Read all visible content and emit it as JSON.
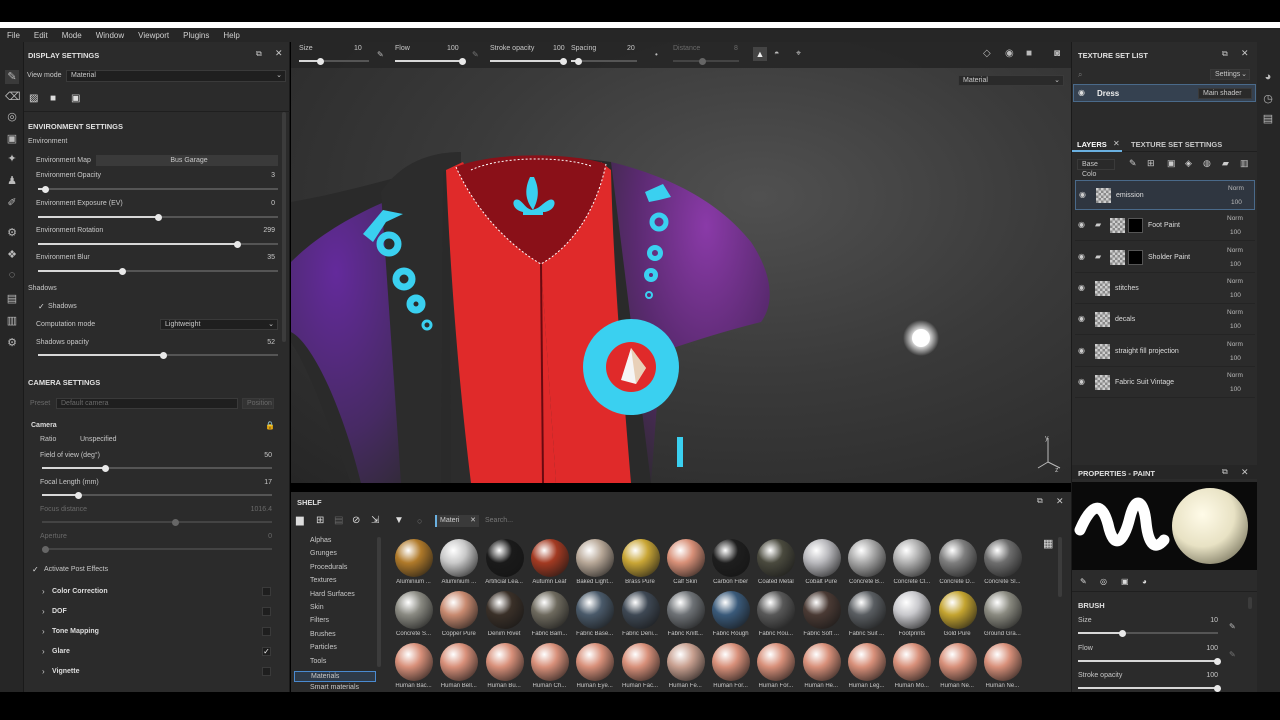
{
  "menu": [
    "File",
    "Edit",
    "Mode",
    "Window",
    "Viewport",
    "Plugins",
    "Help"
  ],
  "display_settings": {
    "title": "DISPLAY SETTINGS",
    "view_mode_label": "View mode",
    "view_mode_value": "Material",
    "environment_settings_title": "ENVIRONMENT SETTINGS",
    "environment_label": "Environment",
    "env_map_label": "Environment Map",
    "env_map_value": "Bus Garage",
    "sliders": [
      {
        "label": "Environment Opacity",
        "value": "3",
        "fraction": 0.03
      },
      {
        "label": "Environment Exposure (EV)",
        "value": "0",
        "fraction": 0.5
      },
      {
        "label": "Environment Rotation",
        "value": "299",
        "fraction": 0.83
      },
      {
        "label": "Environment Blur",
        "value": "35",
        "fraction": 0.35
      }
    ],
    "shadows_label": "Shadows",
    "shadows_check_label": "Shadows",
    "computation_label": "Computation mode",
    "computation_value": "Lightweight",
    "shadows_opacity_label": "Shadows opacity",
    "shadows_opacity_value": "52",
    "camera_settings_title": "CAMERA SETTINGS",
    "preset_label": "Preset",
    "preset_placeholder": "Default camera",
    "preset_btn": "Position",
    "camera_label": "Camera",
    "ratio_label": "Ratio",
    "ratio_value": "Unspecified",
    "fov_label": "Field of view (deg°)",
    "fov_value": "50",
    "focal_label": "Focal Length (mm)",
    "focal_value": "17",
    "focus_label": "Focus distance",
    "focus_value": "1016.4",
    "aperture_label": "Aperture",
    "aperture_value": "0",
    "post_effects_label": "Activate Post Effects",
    "post_effects": [
      "Color Correction",
      "DOF",
      "Tone Mapping",
      "Glare",
      "Vignette"
    ]
  },
  "brush_bar": {
    "size_label": "Size",
    "size_value": "10",
    "flow_label": "Flow",
    "flow_value": "100",
    "stroke_label": "Stroke opacity",
    "stroke_value": "100",
    "spacing_label": "Spacing",
    "spacing_value": "20",
    "distance_label": "Distance",
    "distance_value": "8"
  },
  "viewport": {
    "mode_value": "Material"
  },
  "shelf": {
    "title": "SHELF",
    "filter_tag": "Materi",
    "search_placeholder": "Search...",
    "categories": [
      "Alphas",
      "Grunges",
      "Procedurals",
      "Textures",
      "Hard Surfaces",
      "Skin",
      "Filters",
      "Brushes",
      "Particles",
      "Tools",
      "Materials",
      "Smart materials"
    ],
    "active_category": "Materials",
    "materials": [
      [
        "Aluminium ...",
        "Aluminium ...",
        "Artificial Lea...",
        "Autumn Leaf",
        "Baked Light...",
        "Brass Pure",
        "Calf Skin",
        "Carbon Fiber",
        "Coated Metal",
        "Cobalt Pure",
        "Concrete B...",
        "Concrete Cl...",
        "Concrete D...",
        "Concrete Sl..."
      ],
      [
        "Concrete S...",
        "Copper Pure",
        "Denim Rivet",
        "Fabric Bam...",
        "Fabric Base...",
        "Fabric Deni...",
        "Fabric Knitt...",
        "Fabric Rough",
        "Fabric Rou...",
        "Fabric Soft ...",
        "Fabric Suit ...",
        "Footprints",
        "Gold Pure",
        "Ground Gra..."
      ],
      [
        "Human Bac...",
        "Human Bell...",
        "Human Bu...",
        "Human Ch...",
        "Human Eye...",
        "Human Fac...",
        "Human Fe...",
        "Human For...",
        "Human For...",
        "Human He...",
        "Human Leg...",
        "Human Mo...",
        "Human Ne...",
        "Human Ne..."
      ]
    ],
    "colors": [
      [
        "#b07a2a",
        "#c9c9c9",
        "#1a1a1a",
        "#a33a22",
        "#b8a898",
        "#c9a636",
        "#d89078",
        "#1e1e1e",
        "#4a4a3e",
        "#b8b8bc",
        "#a8a8a8",
        "#b0b0b0",
        "#7e7e7e",
        "#6e6e6e"
      ],
      [
        "#8a8a82",
        "#c88a70",
        "#3a3028",
        "#6e6a5e",
        "#4a5a6a",
        "#3e4854",
        "#6e7276",
        "#3a5a7a",
        "#585858",
        "#4a3a34",
        "#5a5e62",
        "#c8c8cc",
        "#c4a430",
        "#8a8a80"
      ],
      [
        "#d8907a",
        "#d8907a",
        "#d8907a",
        "#d8907a",
        "#d8907a",
        "#d8907a",
        "#c8a090",
        "#d8907a",
        "#d8907a",
        "#d8907a",
        "#d8907a",
        "#d8907a",
        "#d8907a",
        "#d8907a"
      ]
    ]
  },
  "texture_set": {
    "title": "TEXTURE SET LIST",
    "settings_label": "Settings",
    "set_name": "Dress",
    "shader": "Main shader"
  },
  "layers": {
    "tab_layers": "LAYERS",
    "tab_tss": "TEXTURE SET SETTINGS",
    "channel": "Base Colo",
    "items": [
      {
        "name": "emission",
        "blend": "Norm",
        "opacity": "100",
        "folder": false,
        "mask": false
      },
      {
        "name": "Foot Paint",
        "blend": "Norm",
        "opacity": "100",
        "folder": true,
        "mask": true
      },
      {
        "name": "Sholder Paint",
        "blend": "Norm",
        "opacity": "100",
        "folder": true,
        "mask": true
      },
      {
        "name": "stitches",
        "blend": "Norm",
        "opacity": "100",
        "folder": false,
        "mask": false
      },
      {
        "name": "decals",
        "blend": "Norm",
        "opacity": "100",
        "folder": false,
        "mask": false
      },
      {
        "name": "straight fill projection",
        "blend": "Norm",
        "opacity": "100",
        "folder": false,
        "mask": false
      },
      {
        "name": "Fabric Suit Vintage",
        "blend": "Norm",
        "opacity": "100",
        "folder": false,
        "mask": false
      }
    ]
  },
  "properties": {
    "title": "PROPERTIES - PAINT",
    "brush_title": "BRUSH",
    "size_label": "Size",
    "size_value": "10",
    "size_fraction": 0.1,
    "flow_label": "Flow",
    "flow_value": "100",
    "flow_fraction": 1.0,
    "stroke_label": "Stroke opacity",
    "stroke_value": "100"
  }
}
